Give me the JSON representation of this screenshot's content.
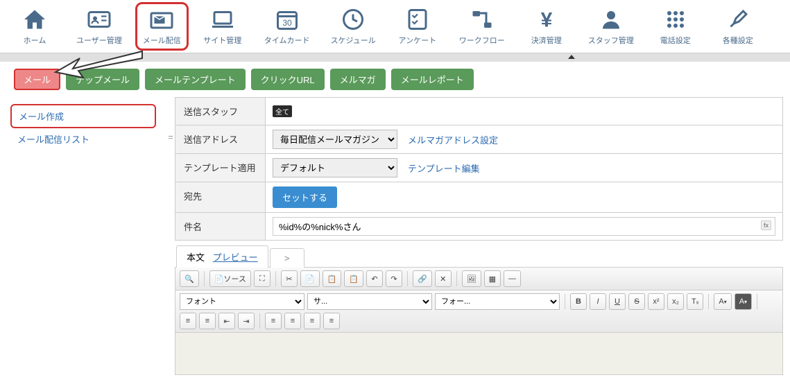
{
  "top_nav": [
    {
      "label": "ホーム",
      "icon": "home"
    },
    {
      "label": "ユーザー管理",
      "icon": "idcard"
    },
    {
      "label": "メール配信",
      "icon": "mail",
      "highlighted": true
    },
    {
      "label": "サイト管理",
      "icon": "laptop"
    },
    {
      "label": "タイムカード",
      "icon": "calendar30"
    },
    {
      "label": "スケジュール",
      "icon": "clock"
    },
    {
      "label": "アンケート",
      "icon": "checklist"
    },
    {
      "label": "ワークフロー",
      "icon": "flow"
    },
    {
      "label": "決済管理",
      "icon": "yen"
    },
    {
      "label": "スタッフ管理",
      "icon": "person"
    },
    {
      "label": "電話設定",
      "icon": "dialpad"
    },
    {
      "label": "各種設定",
      "icon": "tools"
    }
  ],
  "sub_tabs": {
    "mail": "メール",
    "step_mail": "テップメール",
    "mail_template": "メールテンプレート",
    "click_url": "クリックURL",
    "mail_magazine": "メルマガ",
    "mail_report": "メールレポート"
  },
  "side": {
    "compose": "メール作成",
    "delivery_list": "メール配信リスト"
  },
  "form": {
    "sender_staff_label": "送信スタッフ",
    "sender_staff_value": "全て",
    "sender_address_label": "送信アドレス",
    "sender_address_selected": "毎日配信メールマガジン",
    "sender_address_link": "メルマガアドレス設定",
    "template_label": "テンプレート適用",
    "template_selected": "デフォルト",
    "template_link": "テンプレート編集",
    "recipients_label": "宛先",
    "recipients_button": "セットする",
    "subject_label": "件名",
    "subject_value": "%id%の%nick%さん",
    "subject_fx": "fx"
  },
  "body_tabs": {
    "main": "本文",
    "preview": "プレビュー",
    "raw": ">"
  },
  "ck_toolbar": {
    "search": "🔍",
    "source": "ソース",
    "maximize": "⛶",
    "cut": "✂",
    "copy": "📄",
    "paste": "📋",
    "paste_plain": "📋",
    "undo": "↶",
    "redo": "↷",
    "link": "🔗",
    "unlink": "✕",
    "image": "🖼",
    "table": "▦",
    "hr": "—",
    "font": "フォント",
    "size": "サ...",
    "format": "フォー...",
    "bold": "B",
    "italic": "I",
    "underline": "U",
    "strike": "S",
    "sup": "x²",
    "sub": "x₂",
    "remove_fmt": "Tₓ",
    "text_color": "A",
    "bg_color": "A",
    "ol": "≡",
    "ul": "≡",
    "outdent": "⇤",
    "indent": "⇥",
    "align_l": "≡",
    "align_c": "≡",
    "align_r": "≡",
    "align_j": "≡"
  }
}
